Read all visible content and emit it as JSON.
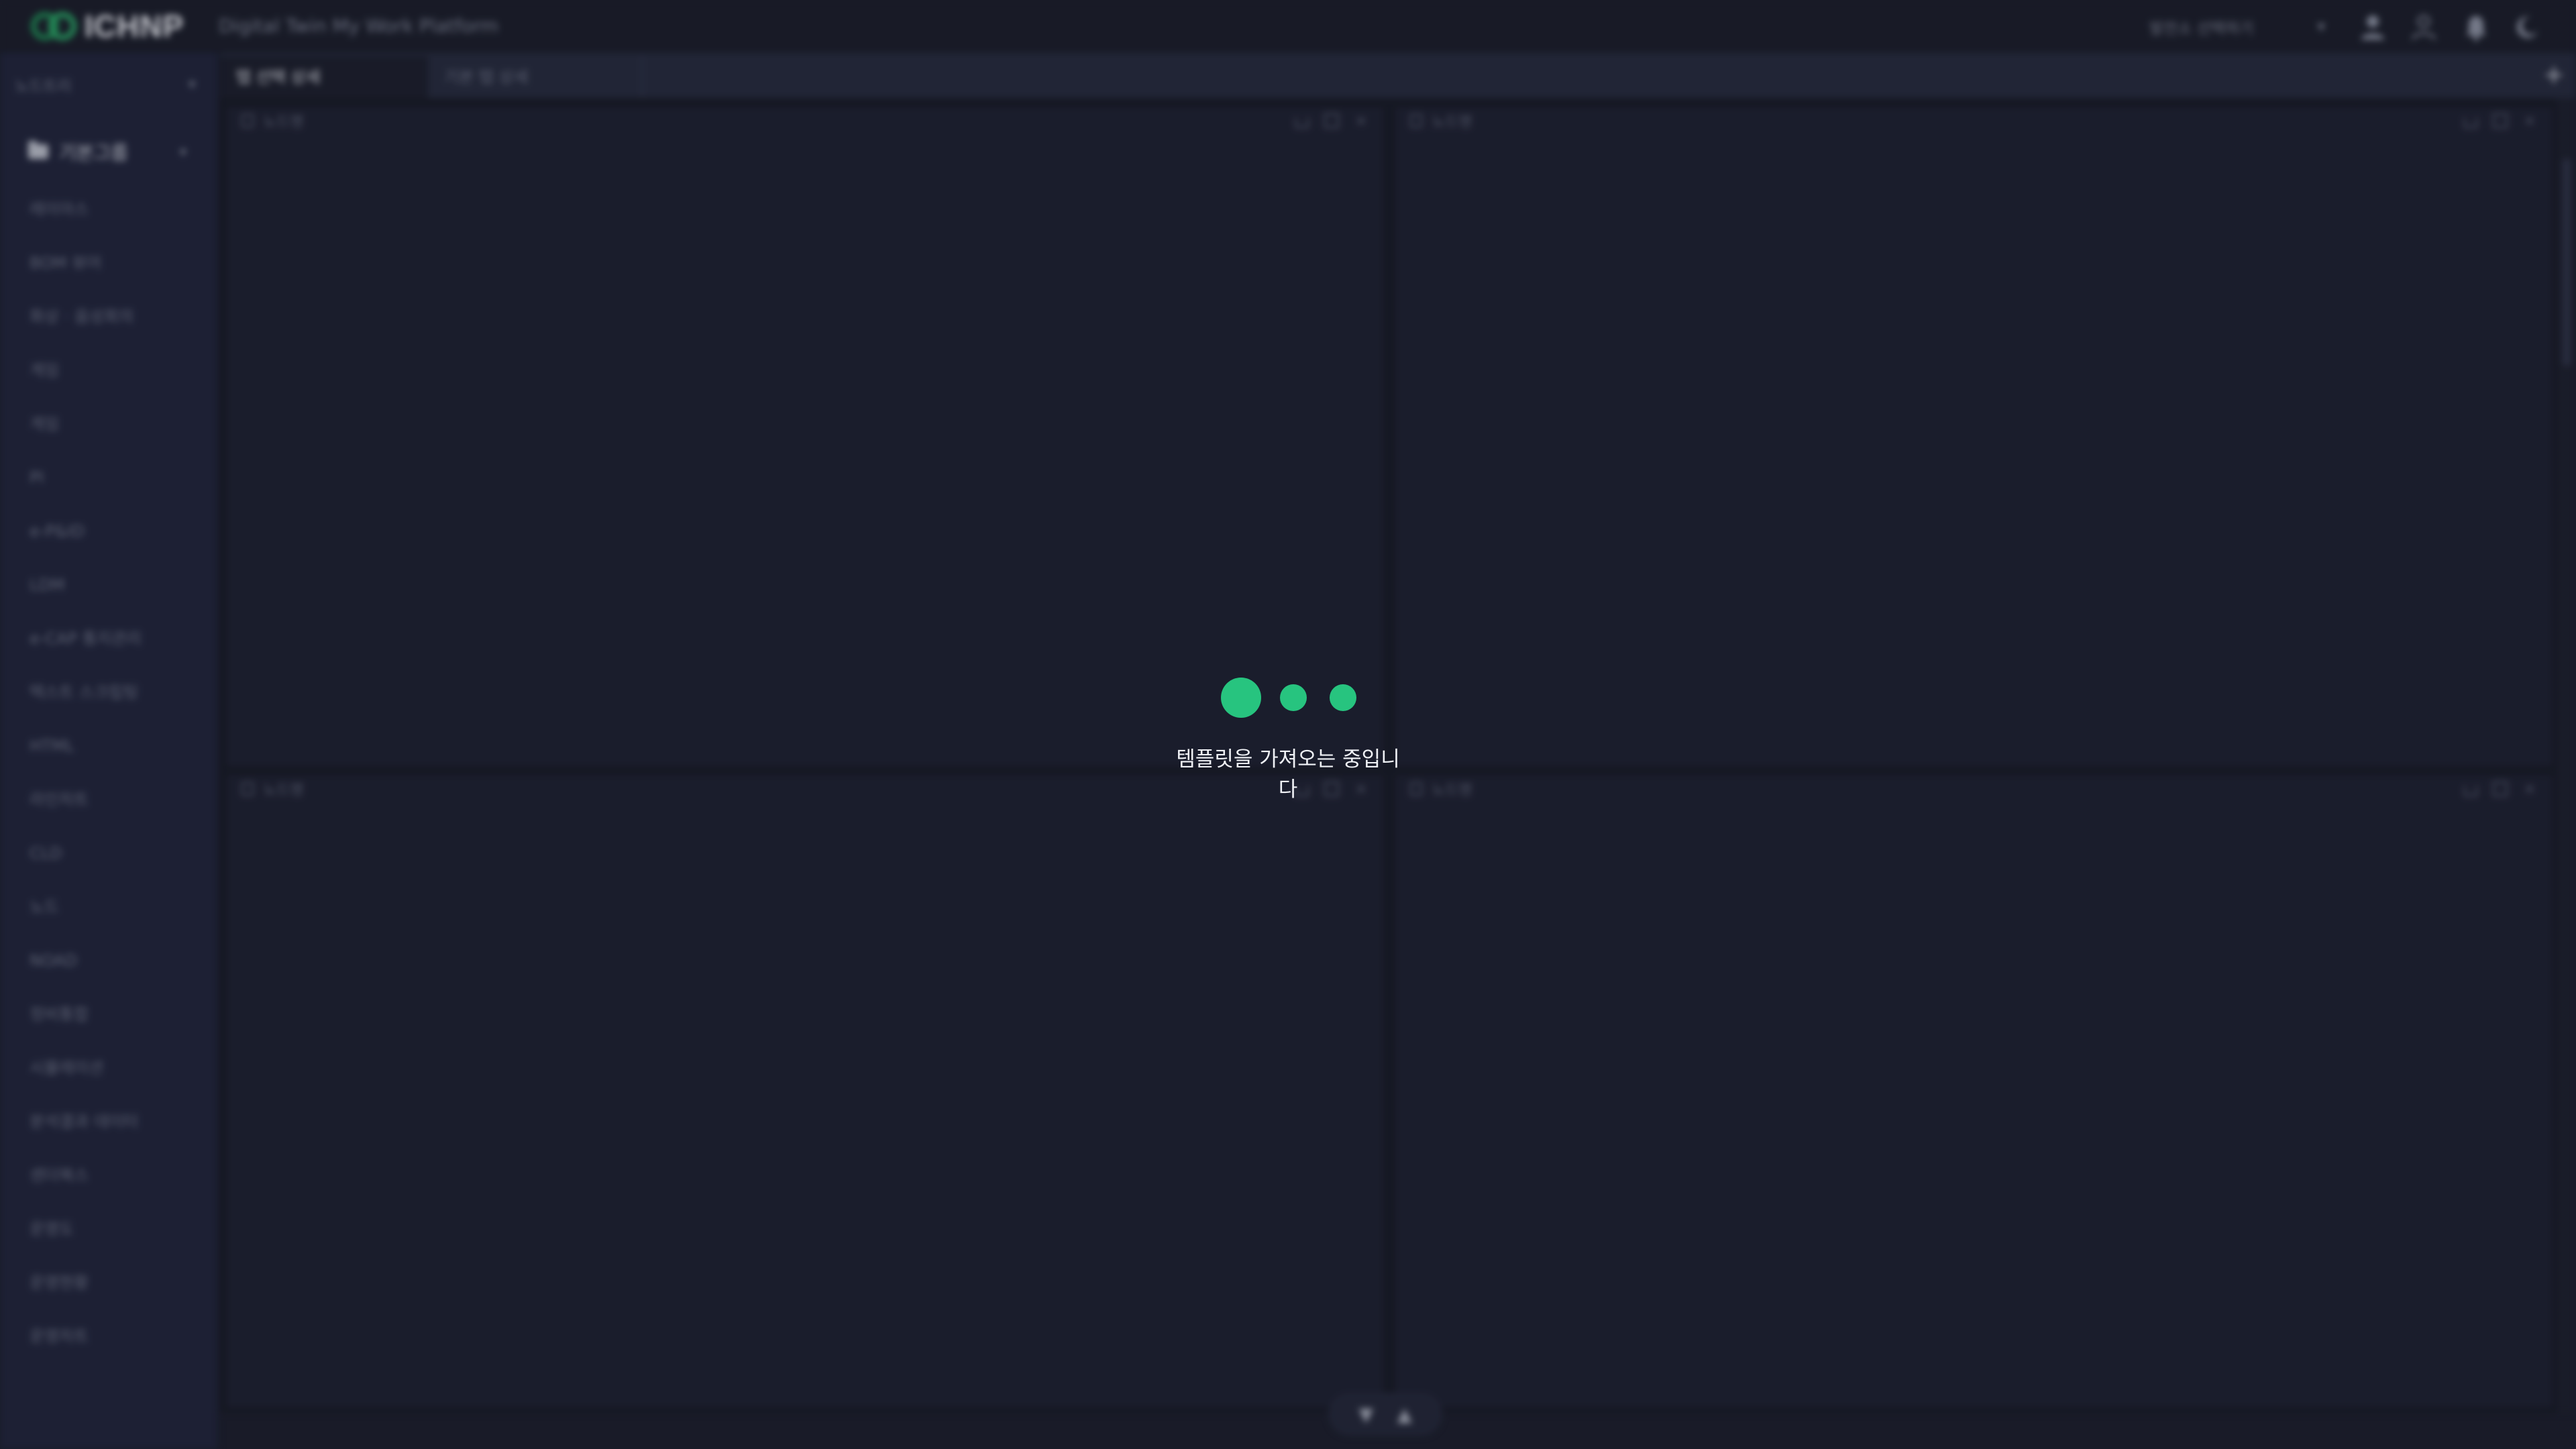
{
  "header": {
    "logo_text": "ICHNP",
    "app_title": "Digital Twin My Work Platform",
    "site_select": "발전소 선택하기"
  },
  "sidebar": {
    "select_label": "노드트리",
    "group_label": "기본그룹",
    "items": [
      "레이아스",
      "BOM 뷰어",
      "화상 · 음성회의",
      "게임",
      "게임",
      "PI",
      "e-P&ID",
      "LDM",
      "e-CAP 통지관리",
      "텍스트 스크립팅",
      "HTML",
      "라인차트",
      "CLD",
      "노드",
      "NOAD",
      "정비통합",
      "시뮬레이션",
      "분석결과 데이터",
      "센더북스",
      "운영도",
      "운영현황",
      "운영차트"
    ]
  },
  "tabs": {
    "active": "탭 선택 상세",
    "inactive": "기본 탭 상세"
  },
  "panels": [
    {
      "title": "노드명"
    },
    {
      "title": "노드명"
    },
    {
      "title": "노드명"
    },
    {
      "title": "노드명"
    }
  ],
  "loading": {
    "message": "템플릿을 가져오는 중입니다",
    "accent": "#27c47f"
  }
}
